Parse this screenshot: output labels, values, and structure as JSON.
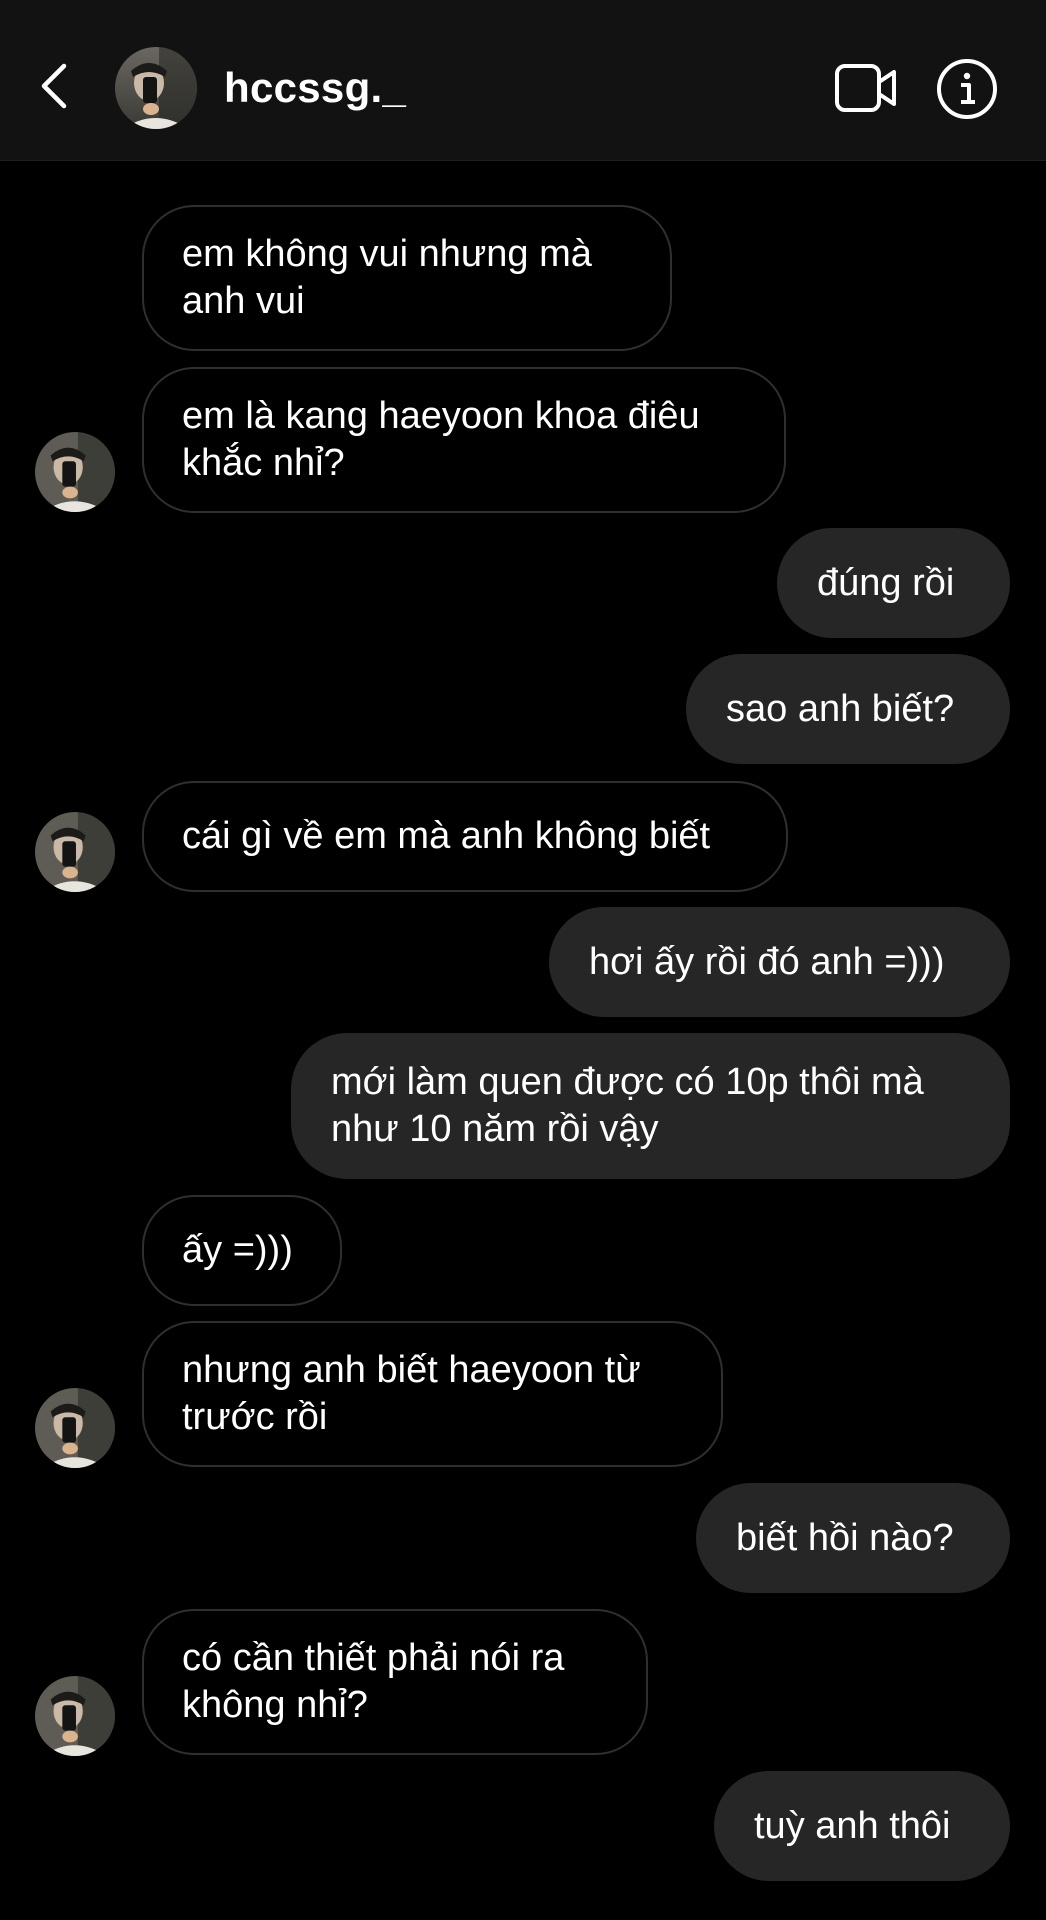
{
  "colors": {
    "background": "#000000",
    "header_background": "#121212",
    "outgoing_bubble": "#262626",
    "incoming_border": "#2f2f2f",
    "text": "#ffffff"
  },
  "header": {
    "username": "hccssg._",
    "back_icon": "chevron-left-icon",
    "video_icon": "video-camera-icon",
    "info_icon": "info-circle-icon"
  },
  "messages": [
    {
      "sender": "them",
      "text": "em không vui nhưng mà\nanh vui"
    },
    {
      "sender": "them",
      "text": "em là kang haeyoon khoa điêu\nkhắc nhỉ?"
    },
    {
      "sender": "me",
      "text": "đúng rồi"
    },
    {
      "sender": "me",
      "text": "sao anh biết?"
    },
    {
      "sender": "them",
      "text": "cái gì về em mà anh không biết"
    },
    {
      "sender": "me",
      "text": "hơi ấy rồi đó anh =)))"
    },
    {
      "sender": "me",
      "text": "mới làm quen được có 10p thôi mà\nnhư 10 năm rồi vậy"
    },
    {
      "sender": "them",
      "text": "ấy =)))"
    },
    {
      "sender": "them",
      "text": "nhưng anh biết haeyoon từ\ntrước rồi"
    },
    {
      "sender": "me",
      "text": "biết hồi nào?"
    },
    {
      "sender": "them",
      "text": "có cần thiết phải nói ra\nkhông nhỉ?"
    },
    {
      "sender": "me",
      "text": "tuỳ anh thôi"
    }
  ]
}
